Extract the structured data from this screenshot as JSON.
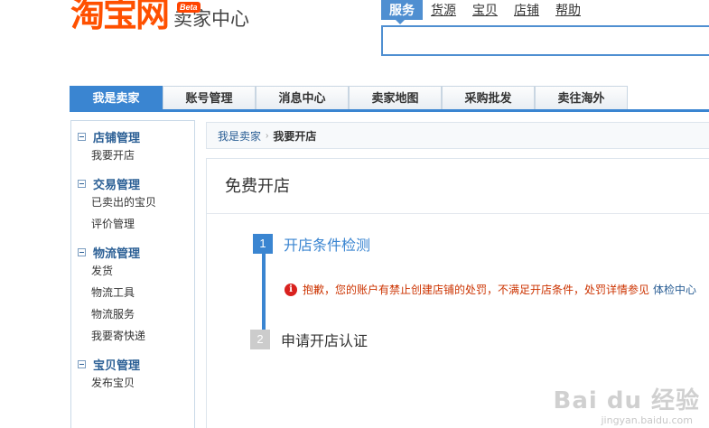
{
  "header": {
    "logo_main": "淘宝网",
    "logo_sub": "卖家中心",
    "beta": "Beta",
    "search_tabs": [
      "服务",
      "货源",
      "宝贝",
      "店铺",
      "帮助"
    ],
    "search_placeholder": ""
  },
  "mainnav": {
    "items": [
      "我是卖家",
      "账号管理",
      "消息中心",
      "卖家地图",
      "采购批发",
      "卖往海外"
    ]
  },
  "sidebar": {
    "groups": [
      {
        "title": "店铺管理",
        "links": [
          "我要开店"
        ]
      },
      {
        "title": "交易管理",
        "links": [
          "已卖出的宝贝",
          "评价管理"
        ]
      },
      {
        "title": "物流管理",
        "links": [
          "发货",
          "物流工具",
          "物流服务",
          "我要寄快递"
        ]
      },
      {
        "title": "宝贝管理",
        "links": [
          "发布宝贝"
        ]
      }
    ]
  },
  "breadcrumb": {
    "root": "我是卖家",
    "separator": "›",
    "current": "我要开店"
  },
  "panel": {
    "title": "免费开店",
    "steps": [
      {
        "num": "1",
        "label": "开店条件检测"
      },
      {
        "num": "2",
        "label": "申请开店认证"
      }
    ],
    "alert": {
      "icon": "i",
      "text": "抱歉，您的账户有禁止创建店铺的处罚，不满足开店条件，处罚详情参见",
      "link": "体检中心"
    }
  },
  "watermark": {
    "main": "Bai du 经验",
    "sub": "jingyan.baidu.com"
  },
  "colors": {
    "brand": "#ff5000",
    "accent": "#3a85d1",
    "alert": "#cc3300"
  }
}
